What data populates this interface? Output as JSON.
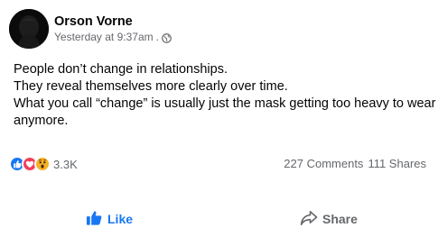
{
  "post": {
    "author": "Orson Vorne",
    "timestamp": "Yesterday at 9:37am",
    "separator": ".",
    "audience_icon": "globe-icon",
    "text_lines": [
      "People don’t change in relationships.",
      "They reveal themselves more clearly over time.",
      "What you call “change” is usually just the mask getting too heavy to wear",
      "anymore."
    ]
  },
  "reactions": {
    "icons": [
      "like-icon",
      "love-icon",
      "wow-icon"
    ],
    "count": "3.3K"
  },
  "stats": {
    "comments": "227 Comments",
    "shares": "111 Shares"
  },
  "actions": {
    "like_label": "Like",
    "share_label": "Share"
  },
  "colors": {
    "like_blue": "#1877f2",
    "love_red": "#f33e58",
    "wow_yellow": "#f7b125",
    "secondary_text": "#65676b"
  }
}
